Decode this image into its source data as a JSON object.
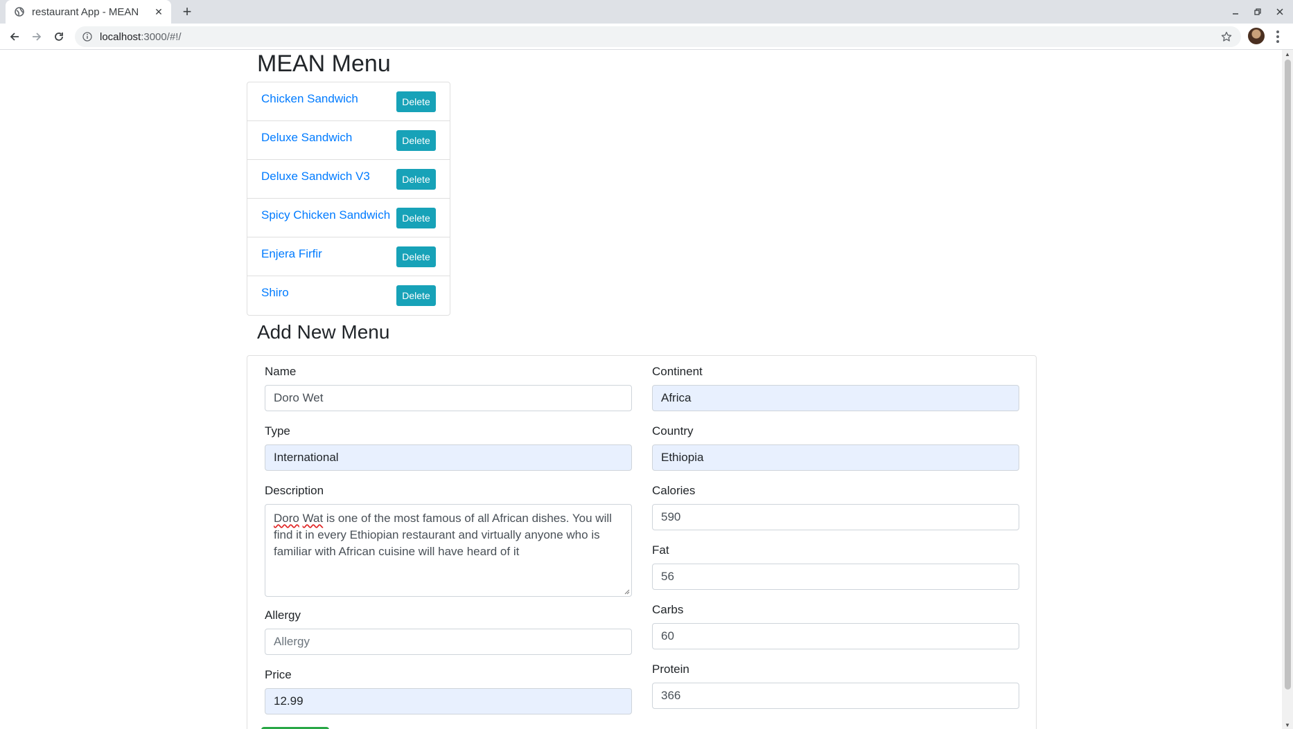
{
  "browser": {
    "tab_title": "restaurant App - MEAN",
    "url_host": "localhost",
    "url_rest": ":3000/#!/"
  },
  "page": {
    "heading": "MEAN Menu",
    "form_heading": "Add New Menu"
  },
  "menu_items": [
    {
      "name": "Chicken Sandwich",
      "action": "Delete"
    },
    {
      "name": "Deluxe Sandwich",
      "action": "Delete"
    },
    {
      "name": "Deluxe Sandwich V3",
      "action": "Delete"
    },
    {
      "name": "Spicy Chicken Sandwich",
      "action": "Delete"
    },
    {
      "name": "Enjera Firfir",
      "action": "Delete"
    },
    {
      "name": "Shiro",
      "action": "Delete"
    }
  ],
  "form": {
    "name": {
      "label": "Name",
      "value": "Doro Wet"
    },
    "type": {
      "label": "Type",
      "value": "International"
    },
    "description": {
      "label": "Description",
      "value": "Doro Wat is one of the most famous of all African dishes.  You will find it in every Ethiopian restaurant and virtually anyone who is familiar with African cuisine will have heard of it",
      "misspelled_1": "Doro",
      "misspelled_2": "Wat",
      "rest": " is one of the most famous of all African dishes.  You will find it in every Ethiopian restaurant and virtually anyone who is familiar with African cuisine will have heard of it"
    },
    "allergy": {
      "label": "Allergy",
      "value": "",
      "placeholder": "Allergy"
    },
    "price": {
      "label": "Price",
      "value": "12.99"
    },
    "continent": {
      "label": "Continent",
      "value": "Africa"
    },
    "country": {
      "label": "Country",
      "value": "Ethiopia"
    },
    "calories": {
      "label": "Calories",
      "value": "590"
    },
    "fat": {
      "label": "Fat",
      "value": "56"
    },
    "carbs": {
      "label": "Carbs",
      "value": "60"
    },
    "protein": {
      "label": "Protein",
      "value": "366"
    }
  },
  "colors": {
    "link": "#007bff",
    "delete_button": "#17a2b8",
    "autofill_bg": "#e8f0fe",
    "submit_button": "#28a745"
  }
}
